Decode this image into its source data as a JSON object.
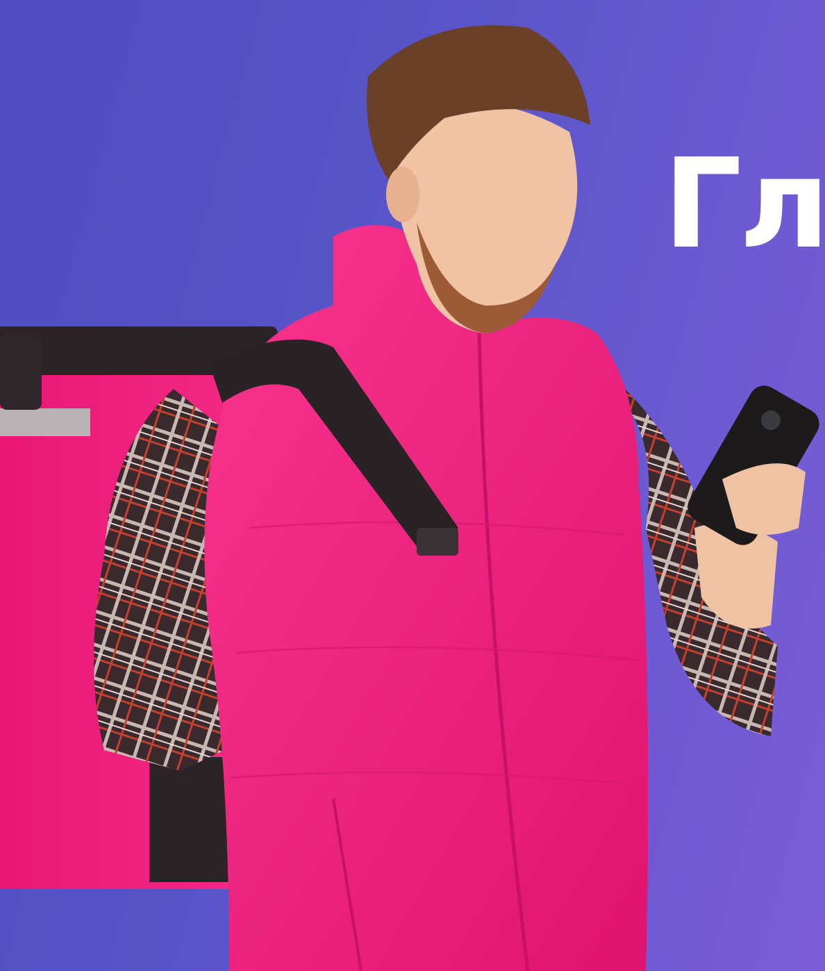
{
  "hero": {
    "headline": "Гла",
    "photo_subject": "courier-with-phone",
    "colors": {
      "background_start": "#4f4dc0",
      "background_end": "#7a5cd6",
      "vest": "#f0237f",
      "headline": "#ffffff"
    }
  }
}
